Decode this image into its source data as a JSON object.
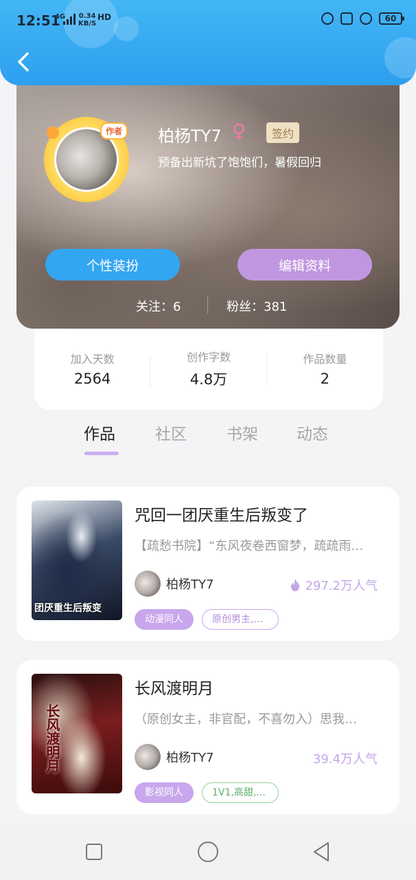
{
  "status_bar": {
    "time": "12:51",
    "net_type": "4G",
    "speed_value": "0.34",
    "speed_unit": "KB/S",
    "hd": "HD",
    "battery": "60"
  },
  "profile": {
    "avatar_badge": "作者",
    "name": "柏杨TY7",
    "gender_symbol": "♀",
    "sign_badge": "签约",
    "bio": "预备出新坑了饱饱们，暑假回归",
    "btn_costume": "个性装扮",
    "btn_edit": "编辑资料",
    "follow": "关注：6",
    "fans": "粉丝：381"
  },
  "stats": [
    {
      "label": "加入天数",
      "value": "2564"
    },
    {
      "label": "创作字数",
      "value": "4.8万"
    },
    {
      "label": "作品数量",
      "value": "2"
    }
  ],
  "tabs": [
    "作品",
    "社区",
    "书架",
    "动态"
  ],
  "active_tab": "作品",
  "works": [
    {
      "cover_text": "团厌重生后叛变",
      "title": "咒回一团厌重生后叛变了",
      "desc": "【疏愁书院】“东风夜卷西窗梦，疏疏雨…",
      "author": "柏杨TY7",
      "popularity": "297.2万人气",
      "tags": [
        "动漫同人",
        "原创男主,..."
      ]
    },
    {
      "cover_text": "长风渡明月",
      "title": "长风渡明月",
      "desc": "（原创女主，非官配，不喜勿入）思我…",
      "author": "柏杨TY7",
      "popularity": "39.4万人气",
      "tags": [
        "影视同人",
        "1V1,高甜,..."
      ]
    }
  ],
  "colors": {
    "header": "#2d9ff0",
    "btn_costume": "#33a6f2",
    "btn_edit": "#c196e0",
    "tag_fill": "#c8a7ec",
    "popularity": "#c2a6ea",
    "tag_green": "#5eb06a"
  }
}
